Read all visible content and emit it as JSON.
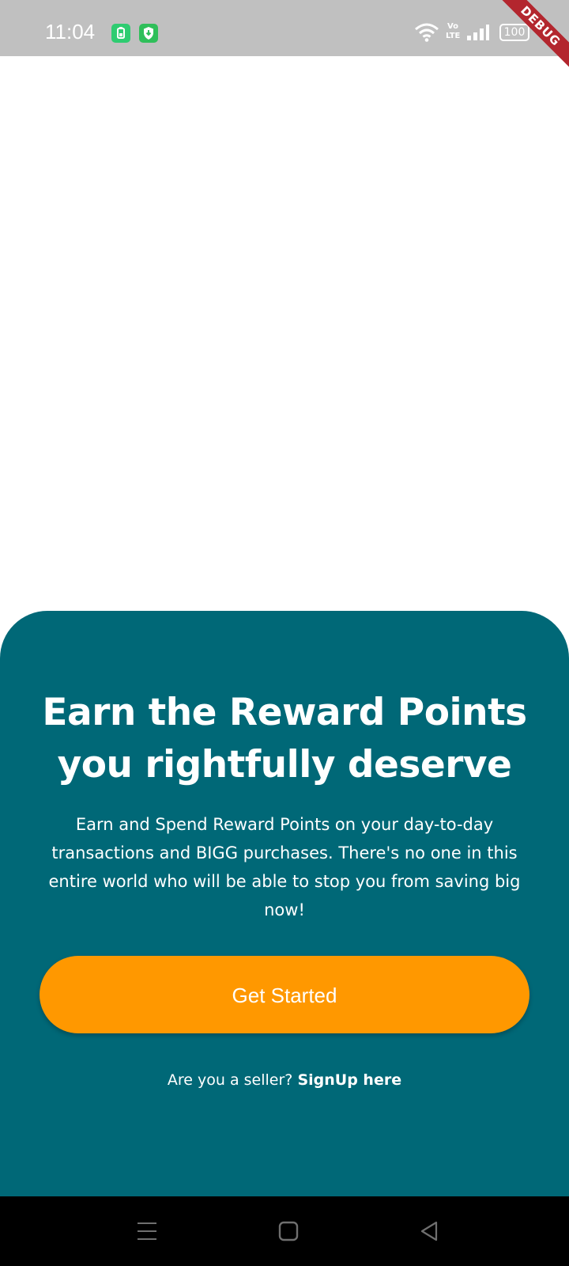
{
  "status_bar": {
    "time": "11:04",
    "volte_label": "Vo LTE",
    "battery": "100",
    "debug_label": "DEBUG"
  },
  "card": {
    "headline_line1": "Earn the Reward Points",
    "headline_line2": "you rightfully deserve",
    "description": "Earn and Spend Reward Points on your day-to-day transactions and BIGG purchases. There's no one in this entire world who will be able to stop you from saving big now!",
    "cta_label": "Get Started",
    "seller_prompt": "Are you a seller?",
    "seller_link": "SignUp here"
  },
  "colors": {
    "card_background": "#006877",
    "cta_background": "#ff9800",
    "status_bar": "#c0c0c0",
    "debug_banner": "#b3262e"
  },
  "icons": {
    "status": [
      "battery-saver-icon",
      "shield-icon",
      "wifi-icon",
      "volte-icon",
      "signal-icon",
      "battery-icon"
    ],
    "navigation": [
      "menu-icon",
      "home-icon",
      "back-icon"
    ]
  }
}
